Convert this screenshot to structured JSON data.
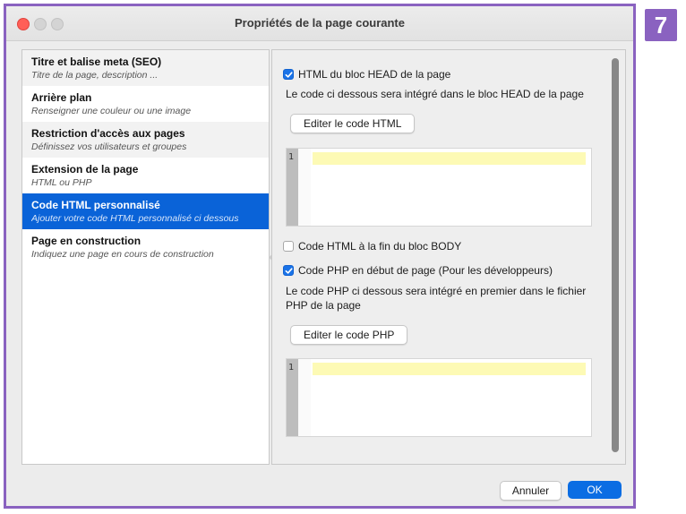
{
  "window": {
    "title": "Propriétés de la page courante"
  },
  "step_badge": "7",
  "colors": {
    "accent": "#0a63d8",
    "frame": "#8a62c0",
    "highlight_line": "#fdfab5"
  },
  "sidebar": {
    "items": [
      {
        "title": "Titre et balise meta (SEO)",
        "subtitle": "Titre de la page, description ..."
      },
      {
        "title": "Arrière plan",
        "subtitle": "Renseigner une couleur ou une image"
      },
      {
        "title": "Restriction d'accès aux pages",
        "subtitle": "Définissez vos utilisateurs et groupes"
      },
      {
        "title": "Extension de la page",
        "subtitle": "HTML ou PHP"
      },
      {
        "title": "Code HTML personnalisé",
        "subtitle": "Ajouter votre code HTML personnalisé ci dessous"
      },
      {
        "title": "Page en construction",
        "subtitle": "Indiquez une page en cours de construction"
      }
    ]
  },
  "panel": {
    "head_section": {
      "checkbox_label": "HTML du bloc HEAD de la page",
      "checked": true,
      "description": "Le code ci dessous sera intégré dans le bloc HEAD de la page",
      "button_label": "Editer le code HTML",
      "line_number": "1"
    },
    "body_section": {
      "checkbox_label": "Code HTML à la fin du bloc BODY",
      "checked": false
    },
    "php_section": {
      "checkbox_label": "Code PHP en début de page (Pour les développeurs)",
      "checked": true,
      "description_line1": "Le code PHP ci dessous sera intégré en premier dans le fichier",
      "description_line2": "PHP de la page",
      "button_label": "Editer le code PHP",
      "line_number": "1"
    }
  },
  "footer": {
    "cancel_label": "Annuler",
    "ok_label": "OK"
  }
}
